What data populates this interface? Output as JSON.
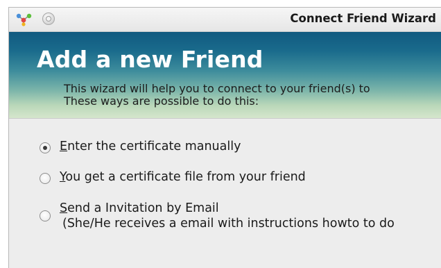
{
  "window": {
    "title": "Connect Friend Wizard"
  },
  "header": {
    "title": "Add a new Friend",
    "subtitle_line1": "This wizard will help you to connect to your friend(s) to",
    "subtitle_line2": "These ways are possible to do this:"
  },
  "options": [
    {
      "mnemonic": "E",
      "label_rest": "nter the certificate manually",
      "selected": true
    },
    {
      "mnemonic": "Y",
      "label_rest": "ou get a certificate file from your friend",
      "selected": false
    },
    {
      "mnemonic": "S",
      "label_rest": "end a Invitation by Email",
      "detail": "(She/He receives a email with instructions howto to do",
      "selected": false
    }
  ],
  "colors": {
    "banner_top": "#115a80",
    "banner_bottom": "#d5e6cc",
    "banner_title": "#ffffff"
  },
  "icons": {
    "app": "retroshare-logo-icon",
    "title_button": "minimize-circle-icon"
  }
}
